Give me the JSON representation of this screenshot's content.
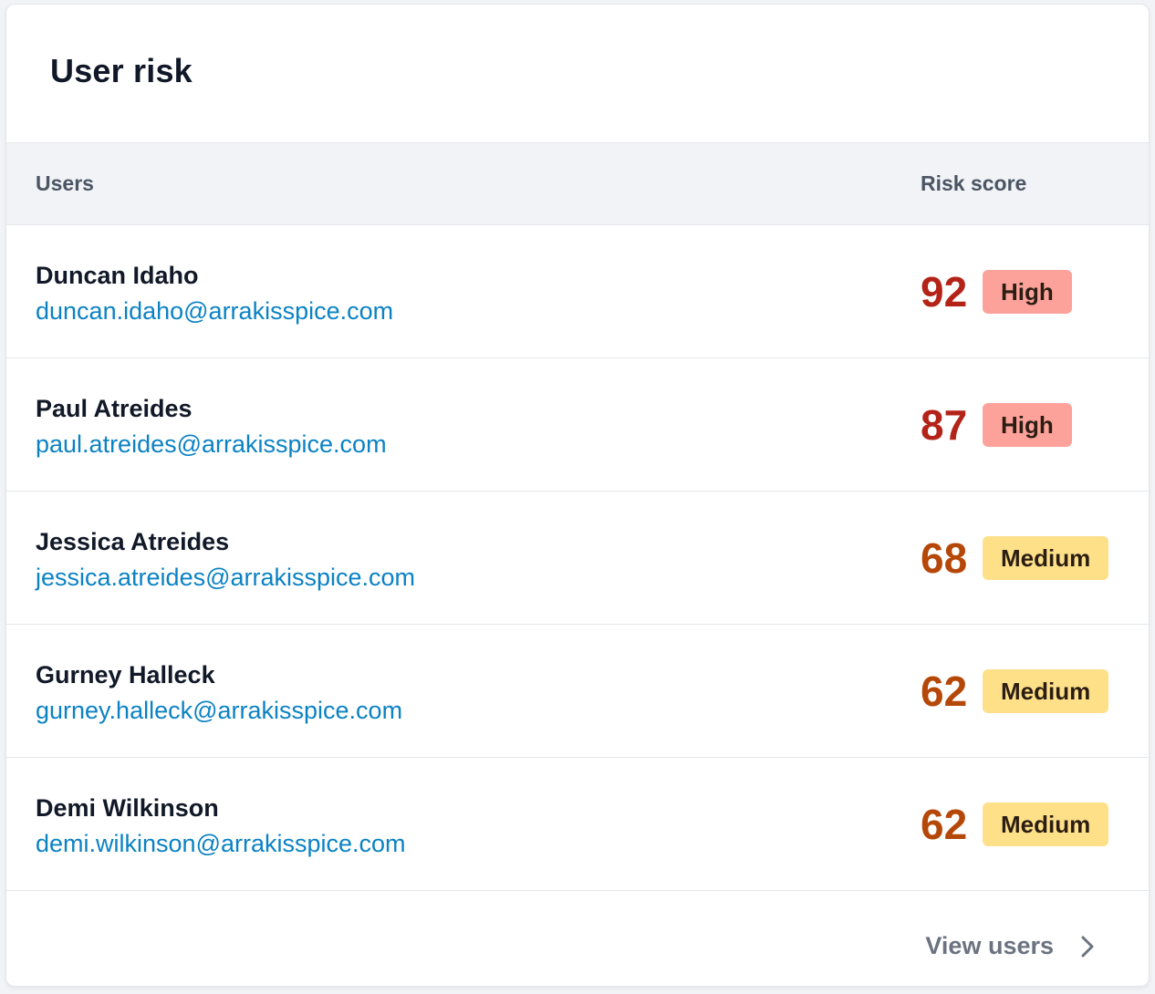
{
  "card": {
    "title": "User risk"
  },
  "table": {
    "columns": {
      "users": "Users",
      "risk_score": "Risk score"
    },
    "rows": [
      {
        "name": "Duncan Idaho",
        "email": "duncan.idaho@arrakisspice.com",
        "score": "92",
        "level": "High",
        "tone": "high"
      },
      {
        "name": "Paul Atreides",
        "email": "paul.atreides@arrakisspice.com",
        "score": "87",
        "level": "High",
        "tone": "high"
      },
      {
        "name": "Jessica Atreides",
        "email": "jessica.atreides@arrakisspice.com",
        "score": "68",
        "level": "Medium",
        "tone": "medium"
      },
      {
        "name": "Gurney Halleck",
        "email": "gurney.halleck@arrakisspice.com",
        "score": "62",
        "level": "Medium",
        "tone": "medium"
      },
      {
        "name": "Demi Wilkinson",
        "email": "demi.wilkinson@arrakisspice.com",
        "score": "62",
        "level": "Medium",
        "tone": "medium"
      }
    ]
  },
  "footer": {
    "link_label": "View users",
    "icon": "chevron-right-icon"
  },
  "colors": {
    "high_score": "#b42318",
    "high_badge": "#fda29b",
    "medium_score": "#b54708",
    "medium_badge": "#fee089",
    "email_link": "#0b82c4"
  }
}
